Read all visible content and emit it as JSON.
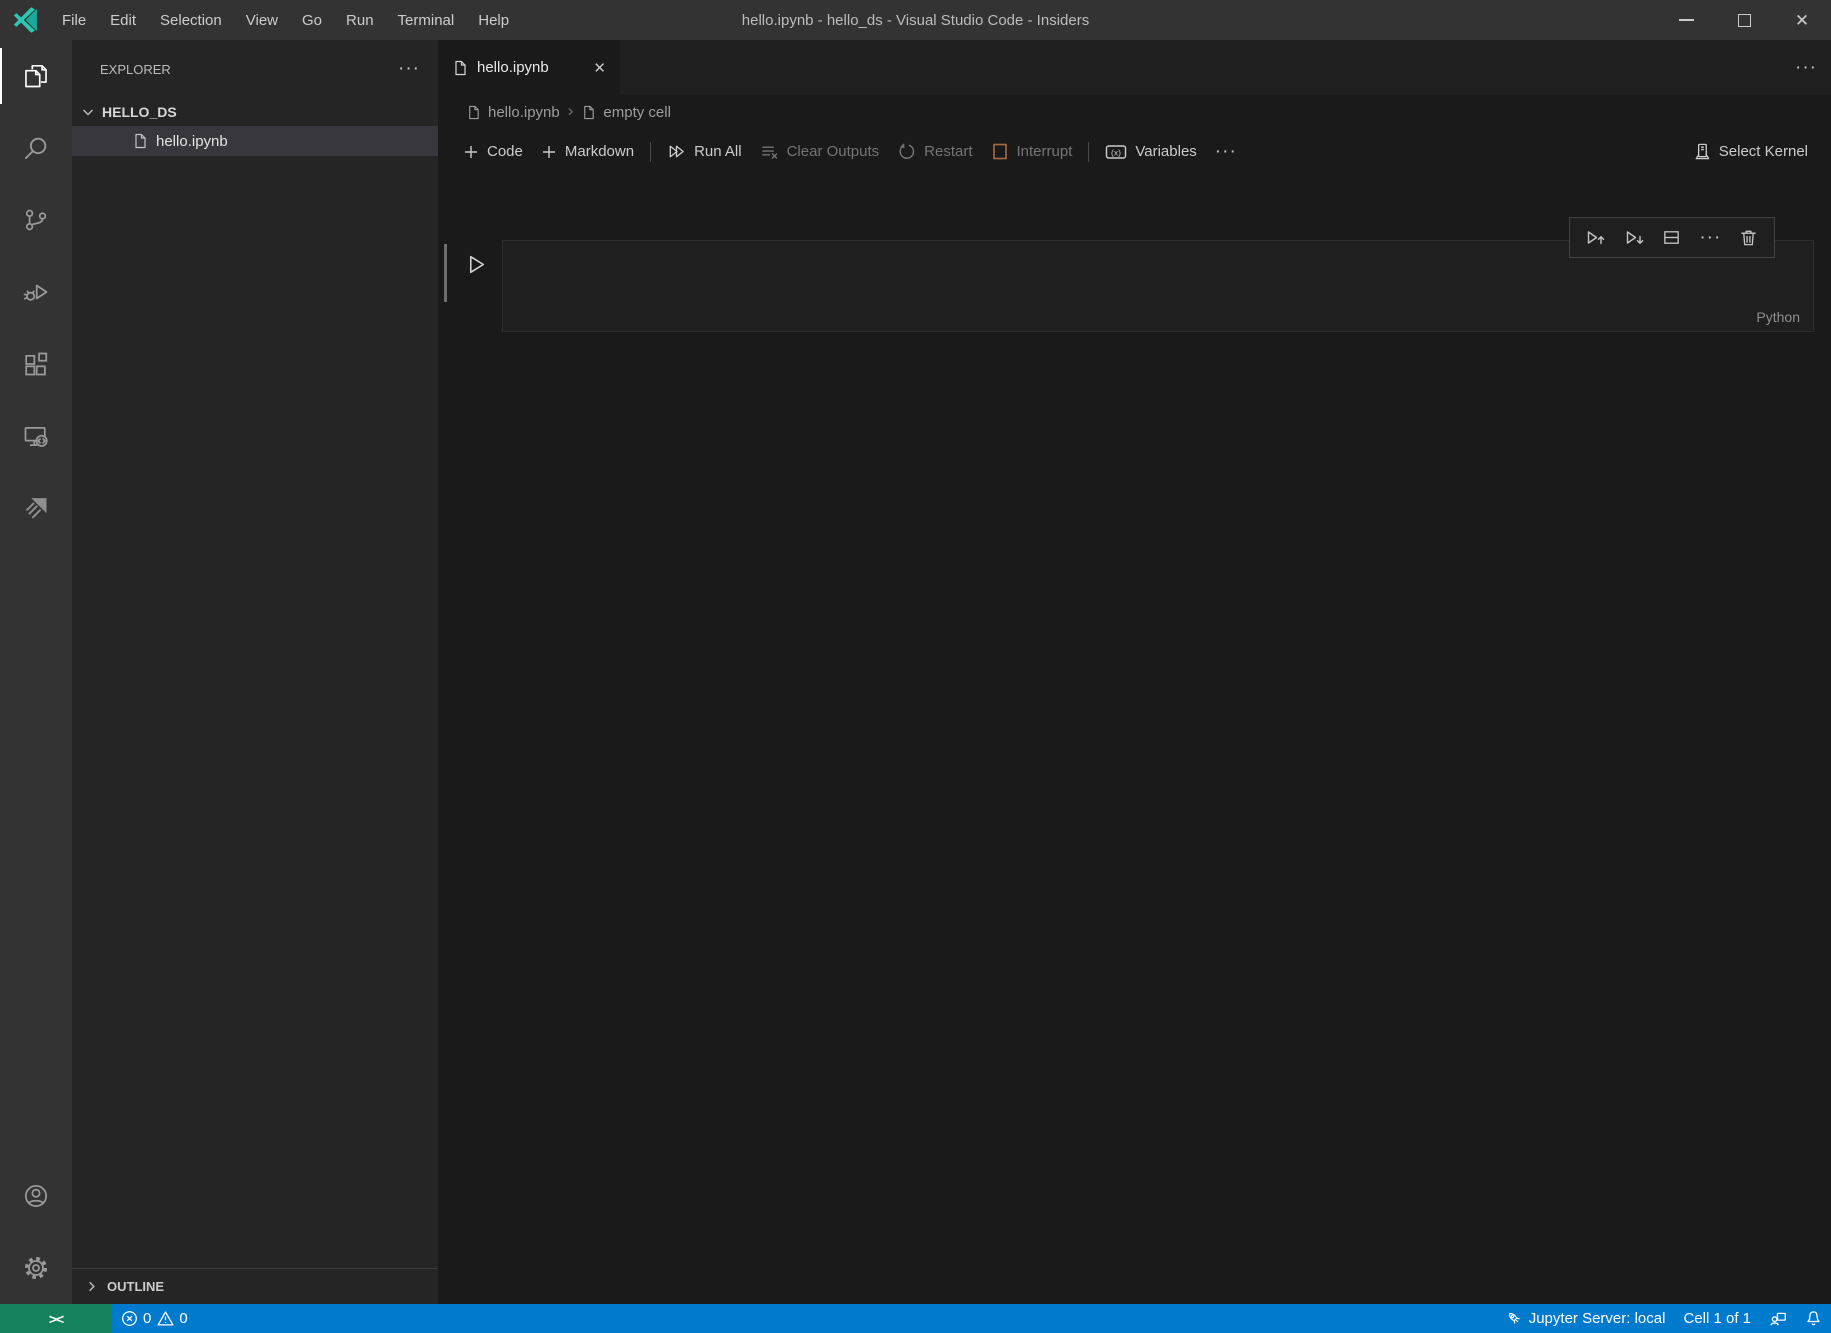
{
  "colors": {
    "titlebar_bg": "#333333",
    "activitybar_bg": "#333333",
    "sidebar_bg": "#252526",
    "editor_bg": "#1a1a1a",
    "tabstrip_bg": "#1f1f1f",
    "cell_bg": "#1f1f1f",
    "selection_bg": "#37373d",
    "statusbar_bg": "#007acc",
    "remote_bg": "#16825d",
    "logo_accent": "#2bc7b4",
    "interrupt_icon_color": "#a96a45"
  },
  "title_bar": {
    "menus": [
      "File",
      "Edit",
      "Selection",
      "View",
      "Go",
      "Run",
      "Terminal",
      "Help"
    ],
    "window_title": "hello.ipynb - hello_ds - Visual Studio Code - Insiders",
    "window_controls": [
      "minimize",
      "maximize",
      "close"
    ]
  },
  "activity_bar": {
    "items": [
      {
        "icon": "files-icon",
        "active": true
      },
      {
        "icon": "search-icon"
      },
      {
        "icon": "source-control-icon"
      },
      {
        "icon": "run-and-debug-icon"
      },
      {
        "icon": "extensions-icon"
      },
      {
        "icon": "remote-explorer-icon"
      },
      {
        "icon": "triangle-extension-icon"
      }
    ],
    "bottom": [
      {
        "icon": "accounts-icon"
      },
      {
        "icon": "settings-gear-icon"
      }
    ]
  },
  "sidebar": {
    "title": "EXPLORER",
    "folder_section": "HELLO_DS",
    "files": [
      {
        "name": "hello.ipynb",
        "selected": true
      }
    ],
    "outline_section": "OUTLINE"
  },
  "editor": {
    "tab": {
      "label": "hello.ipynb"
    },
    "breadcrumbs": {
      "file": "hello.ipynb",
      "cell": "empty cell"
    },
    "toolbar": {
      "code": "Code",
      "markdown": "Markdown",
      "run_all": "Run All",
      "clear_outputs": "Clear Outputs",
      "restart": "Restart",
      "interrupt": "Interrupt",
      "variables": "Variables",
      "more": "⋯",
      "select_kernel": "Select Kernel"
    },
    "cell": {
      "language": "Python"
    }
  },
  "status_bar": {
    "remote_glyph": "><",
    "error_count": "0",
    "warning_count": "0",
    "jupyter_server": "Jupyter Server: local",
    "cell_position": "Cell 1 of 1"
  }
}
